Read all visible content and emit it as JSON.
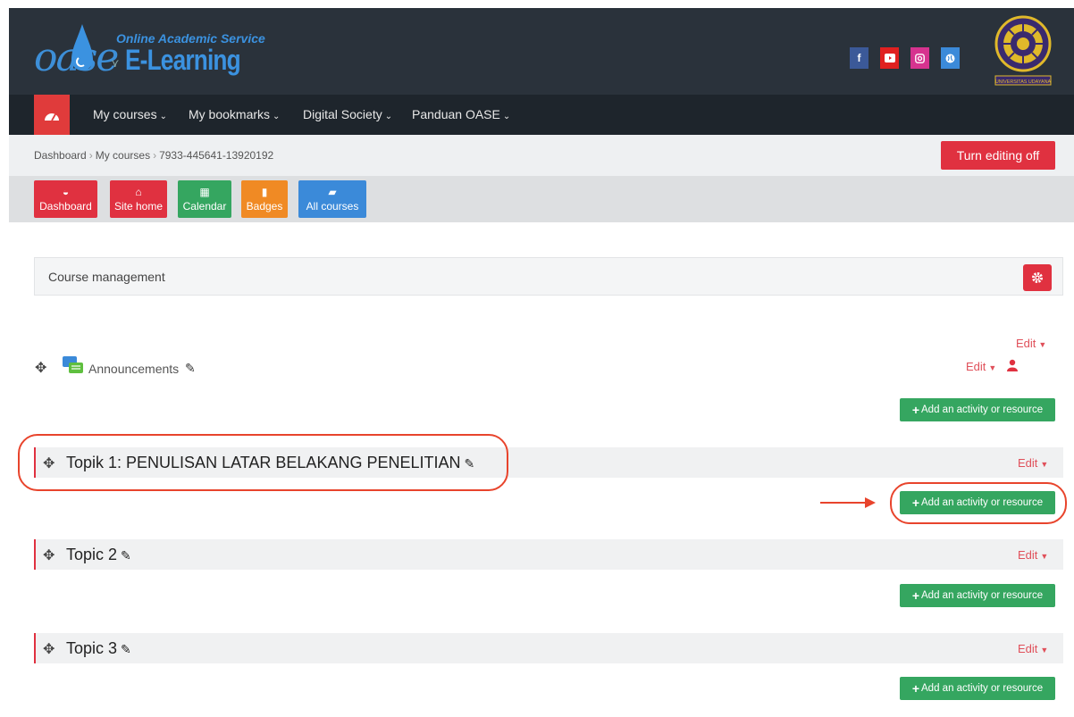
{
  "header": {
    "logo_small": "Online Academic Service",
    "logo_big": "E-Learning",
    "logo_prefix": "oase",
    "social": [
      {
        "name": "facebook-icon",
        "glyph": "f",
        "color": "#3b5998"
      },
      {
        "name": "youtube-icon",
        "glyph": "▶",
        "color": "#e02020"
      },
      {
        "name": "instagram-icon",
        "glyph": "◎",
        "color": "#d6338f"
      },
      {
        "name": "web-icon",
        "glyph": "◍",
        "color": "#3b8ad9"
      }
    ],
    "seal_text": "UNIVERSITAS UDAYANA"
  },
  "nav": {
    "items": [
      {
        "label": "My courses"
      },
      {
        "label": "My bookmarks"
      },
      {
        "label": "Digital Society"
      },
      {
        "label": "Panduan OASE"
      }
    ]
  },
  "breadcrumb": {
    "items": [
      "Dashboard",
      "My courses",
      "7933-445641-13920192"
    ],
    "edit_button": "Turn editing off"
  },
  "quick": [
    {
      "label": "Dashboard",
      "icon": "dashboard-icon",
      "color": "#e03140"
    },
    {
      "label": "Site home",
      "icon": "home-icon",
      "color": "#e03140"
    },
    {
      "label": "Calendar",
      "icon": "calendar-icon",
      "color": "#35a660"
    },
    {
      "label": "Badges",
      "icon": "badge-icon",
      "color": "#f08a24"
    },
    {
      "label": "All courses",
      "icon": "book-icon",
      "color": "#3b8ad9"
    }
  ],
  "course_management": {
    "label": "Course management"
  },
  "sections": {
    "general_edit": "Edit",
    "announcements": {
      "label": "Announcements",
      "edit": "Edit"
    },
    "add_label": "Add an activity or resource",
    "topics": [
      {
        "title": "Topik 1: PENULISAN LATAR BELAKANG PENELITIAN",
        "edit": "Edit"
      },
      {
        "title": "Topic 2",
        "edit": "Edit"
      },
      {
        "title": "Topic 3",
        "edit": "Edit"
      }
    ]
  },
  "colors": {
    "header_bg": "#2a323b",
    "nav_bg": "#1e252c",
    "accent_red": "#e03140",
    "green": "#35a660",
    "annotation": "#e8442c"
  }
}
